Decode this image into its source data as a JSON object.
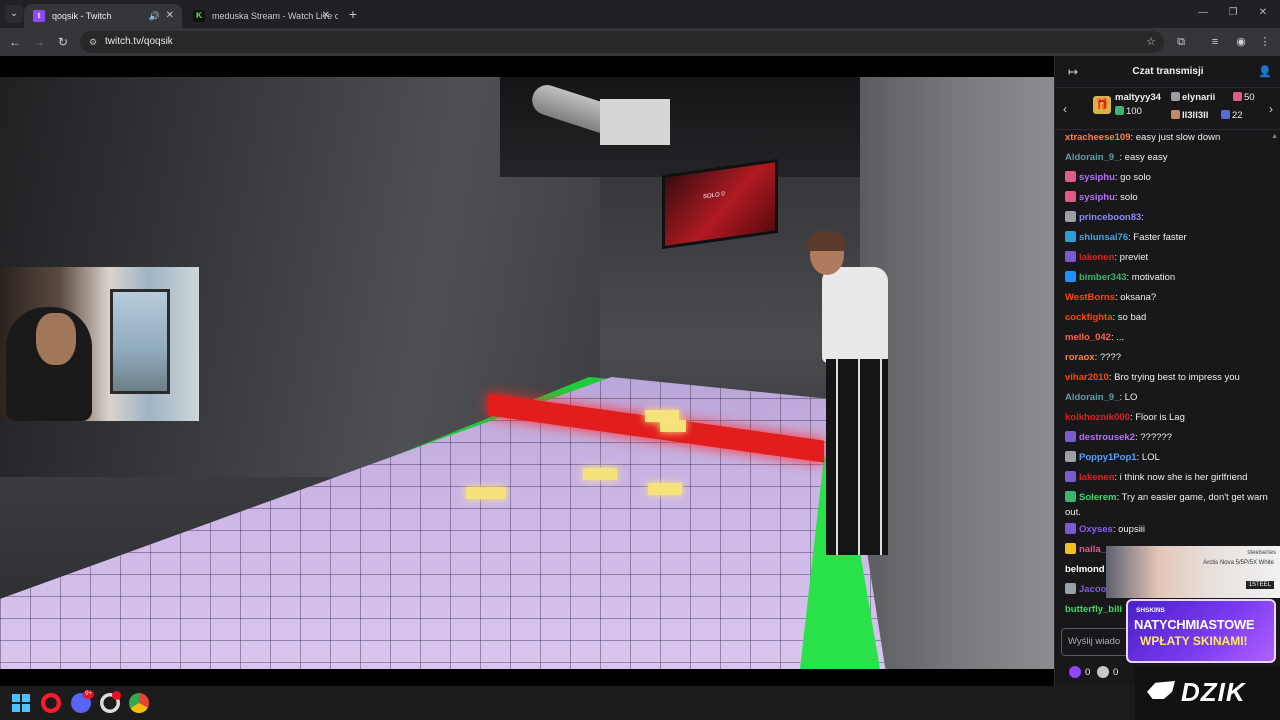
{
  "browser": {
    "tabs": [
      {
        "title": "qoqsik - Twitch",
        "favicon": "twitch-icon",
        "active": true
      },
      {
        "title": "meduska Stream - Watch Live o",
        "favicon": "kick-icon",
        "active": false
      }
    ],
    "url": "twitch.tv/qoqsik"
  },
  "stream": {
    "overlay_tv_text": "SOLO 0"
  },
  "chat": {
    "title": "Czat transmisji",
    "leaderboard": [
      {
        "user": "maltyyy34",
        "value": "100"
      },
      {
        "user": "elynarii",
        "value": "50"
      },
      {
        "user": "ll3ll3ll",
        "value": "22"
      }
    ],
    "messages": [
      {
        "user": "xtracheese109",
        "text": ": easy just slow down",
        "color": "#ff7f50",
        "badge": ""
      },
      {
        "user": "Aldorain_9_",
        "text": ": easy easy",
        "color": "#5f9ea0",
        "badge": ""
      },
      {
        "user": "sysiphu",
        "text": ": go solo",
        "color": "#b86efc",
        "badge": "#e05a8a"
      },
      {
        "user": "sysiphu",
        "text": ": solo",
        "color": "#b86efc",
        "badge": "#e05a8a"
      },
      {
        "user": "princeboon83",
        "text": ":",
        "color": "#8a8aff",
        "badge": "#9aa0a6"
      },
      {
        "user": "shiunsai76",
        "text": ": Faster faster",
        "color": "#4aa3df",
        "badge": "#2ea0d8"
      },
      {
        "user": "lakenen",
        "text": ": previet",
        "color": "#e02020",
        "badge": "#7a5cd1"
      },
      {
        "user": "bimber343",
        "text": ": motivation",
        "color": "#3cb371",
        "badge": "#1e90ff"
      },
      {
        "user": "WestBorns",
        "text": ": oksana?",
        "color": "#ff4500",
        "badge": ""
      },
      {
        "user": "cockfighta",
        "text": ": so bad",
        "color": "#ff4500",
        "badge": ""
      },
      {
        "user": "mello_042",
        "text": ": ...",
        "color": "#ff6347",
        "badge": ""
      },
      {
        "user": "roraox",
        "text": ": ????",
        "color": "#ff7f50",
        "badge": ""
      },
      {
        "user": "vihar2010",
        "text": ": Bro trying best to impress you",
        "color": "#ff4500",
        "badge": ""
      },
      {
        "user": "Aldorain_9_",
        "text": ": LO",
        "color": "#5f9ea0",
        "badge": ""
      },
      {
        "user": "kolkhoznik000",
        "text": ": Floor is Lag",
        "color": "#e02020",
        "badge": ""
      },
      {
        "user": "destrousek2",
        "text": ": ??????",
        "color": "#b86efc",
        "badge": "#7a5cd1"
      },
      {
        "user": "Poppy1Pop1",
        "text": ": LOL",
        "color": "#5aa0ff",
        "badge": "#9aa0a6"
      },
      {
        "user": "lakenen",
        "text": ": i think now she is her girlfriend",
        "color": "#e02020",
        "badge": "#7a5cd1"
      },
      {
        "user": "Solerem",
        "text": ": Try an easier game, don't get warn out.",
        "color": "#3cdb6c",
        "badge": "#3cb371"
      },
      {
        "user": "Oxyses",
        "text": ": oupsiii",
        "color": "#8a5cff",
        "badge": "#7a5cd1"
      },
      {
        "user": "naila_",
        "text": "",
        "color": "#e05a8a",
        "badge": "#f0c020"
      },
      {
        "user": "belmond",
        "text": "",
        "color": "#ffffff",
        "badge": ""
      },
      {
        "user": "Jacoo",
        "text": "",
        "color": "#7a5cd1",
        "badge": "#9aa0a6"
      },
      {
        "user": "butterfly_bili",
        "text": "",
        "color": "#3cdb6c",
        "badge": ""
      }
    ],
    "input_placeholder": "Wyślij wiado",
    "footer": {
      "bits": "0",
      "points": "0"
    }
  },
  "ads": {
    "headset_brand": "steelseries",
    "headset_product": "Arctis Nova 5/5P/5X White",
    "headset_tag": "1STEEL",
    "skins_brand": "SHSKINS",
    "skins_line1": "NATYCHMIASTOWE",
    "skins_line2": "WPŁATY SKINAMI!",
    "dzik_text": "DZIK"
  },
  "taskbar": {
    "discord_badge": "9+"
  }
}
